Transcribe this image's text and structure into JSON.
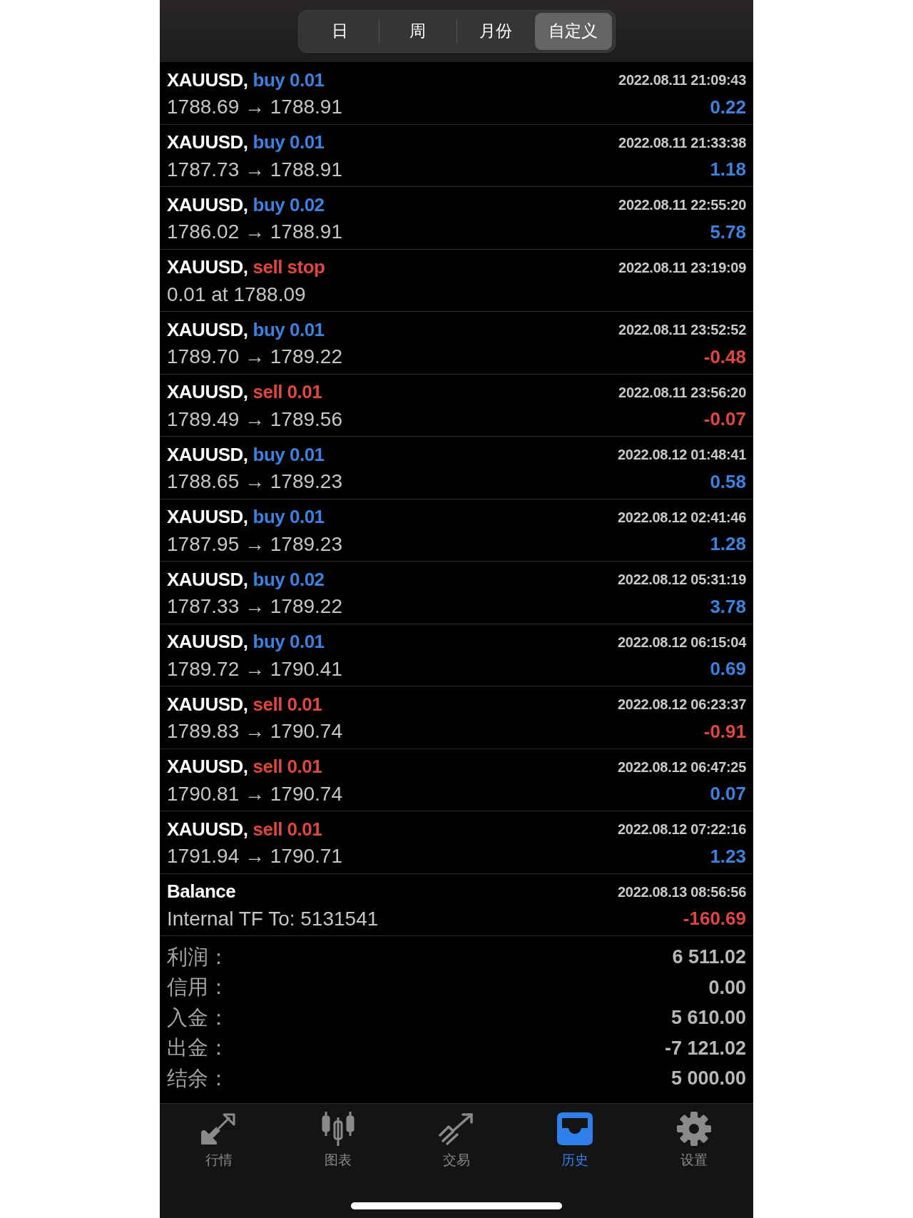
{
  "period_tabs": [
    {
      "label": "日",
      "selected": false
    },
    {
      "label": "周",
      "selected": false
    },
    {
      "label": "月份",
      "selected": false
    },
    {
      "label": "自定义",
      "selected": true
    }
  ],
  "history": [
    {
      "kind": "trade",
      "symbol": "XAUUSD,",
      "order": "buy 0.01",
      "sell": false,
      "time": "2022.08.11 21:09:43",
      "detail": "1788.69 → 1788.91",
      "profit": "0.22",
      "loss": false
    },
    {
      "kind": "trade",
      "symbol": "XAUUSD,",
      "order": "buy 0.01",
      "sell": false,
      "time": "2022.08.11 21:33:38",
      "detail": "1787.73 → 1788.91",
      "profit": "1.18",
      "loss": false
    },
    {
      "kind": "trade",
      "symbol": "XAUUSD,",
      "order": "buy 0.02",
      "sell": false,
      "time": "2022.08.11 22:55:20",
      "detail": "1786.02 → 1788.91",
      "profit": "5.78",
      "loss": false
    },
    {
      "kind": "order",
      "symbol": "XAUUSD,",
      "order": "sell stop",
      "sell": true,
      "time": "2022.08.11 23:19:09",
      "detail": "0.01 at 1788.09"
    },
    {
      "kind": "trade",
      "symbol": "XAUUSD,",
      "order": "buy 0.01",
      "sell": false,
      "time": "2022.08.11 23:52:52",
      "detail": "1789.70 → 1789.22",
      "profit": "-0.48",
      "loss": true
    },
    {
      "kind": "trade",
      "symbol": "XAUUSD,",
      "order": "sell 0.01",
      "sell": true,
      "time": "2022.08.11 23:56:20",
      "detail": "1789.49 → 1789.56",
      "profit": "-0.07",
      "loss": true
    },
    {
      "kind": "trade",
      "symbol": "XAUUSD,",
      "order": "buy 0.01",
      "sell": false,
      "time": "2022.08.12 01:48:41",
      "detail": "1788.65 → 1789.23",
      "profit": "0.58",
      "loss": false
    },
    {
      "kind": "trade",
      "symbol": "XAUUSD,",
      "order": "buy 0.01",
      "sell": false,
      "time": "2022.08.12 02:41:46",
      "detail": "1787.95 → 1789.23",
      "profit": "1.28",
      "loss": false
    },
    {
      "kind": "trade",
      "symbol": "XAUUSD,",
      "order": "buy 0.02",
      "sell": false,
      "time": "2022.08.12 05:31:19",
      "detail": "1787.33 → 1789.22",
      "profit": "3.78",
      "loss": false
    },
    {
      "kind": "trade",
      "symbol": "XAUUSD,",
      "order": "buy 0.01",
      "sell": false,
      "time": "2022.08.12 06:15:04",
      "detail": "1789.72 → 1790.41",
      "profit": "0.69",
      "loss": false
    },
    {
      "kind": "trade",
      "symbol": "XAUUSD,",
      "order": "sell 0.01",
      "sell": true,
      "time": "2022.08.12 06:23:37",
      "detail": "1789.83 → 1790.74",
      "profit": "-0.91",
      "loss": true
    },
    {
      "kind": "trade",
      "symbol": "XAUUSD,",
      "order": "sell 0.01",
      "sell": true,
      "time": "2022.08.12 06:47:25",
      "detail": "1790.81 → 1790.74",
      "profit": "0.07",
      "loss": false
    },
    {
      "kind": "trade",
      "symbol": "XAUUSD,",
      "order": "sell 0.01",
      "sell": true,
      "time": "2022.08.12 07:22:16",
      "detail": "1791.94 → 1790.71",
      "profit": "1.23",
      "loss": false
    },
    {
      "kind": "balance",
      "title": "Balance",
      "time": "2022.08.13 08:56:56",
      "detail": "Internal TF To: 5131541",
      "profit": "-160.69",
      "loss": true
    }
  ],
  "summary": [
    {
      "label": "利润：",
      "value": "6 511.02"
    },
    {
      "label": "信用：",
      "value": "0.00"
    },
    {
      "label": "入金：",
      "value": "5 610.00"
    },
    {
      "label": "出金：",
      "value": "-7 121.02"
    },
    {
      "label": "结余：",
      "value": "5 000.00"
    }
  ],
  "bottom_tabs": [
    {
      "label": "行情",
      "selected": false
    },
    {
      "label": "图表",
      "selected": false
    },
    {
      "label": "交易",
      "selected": false
    },
    {
      "label": "历史",
      "selected": true
    },
    {
      "label": "设置",
      "selected": false
    }
  ]
}
